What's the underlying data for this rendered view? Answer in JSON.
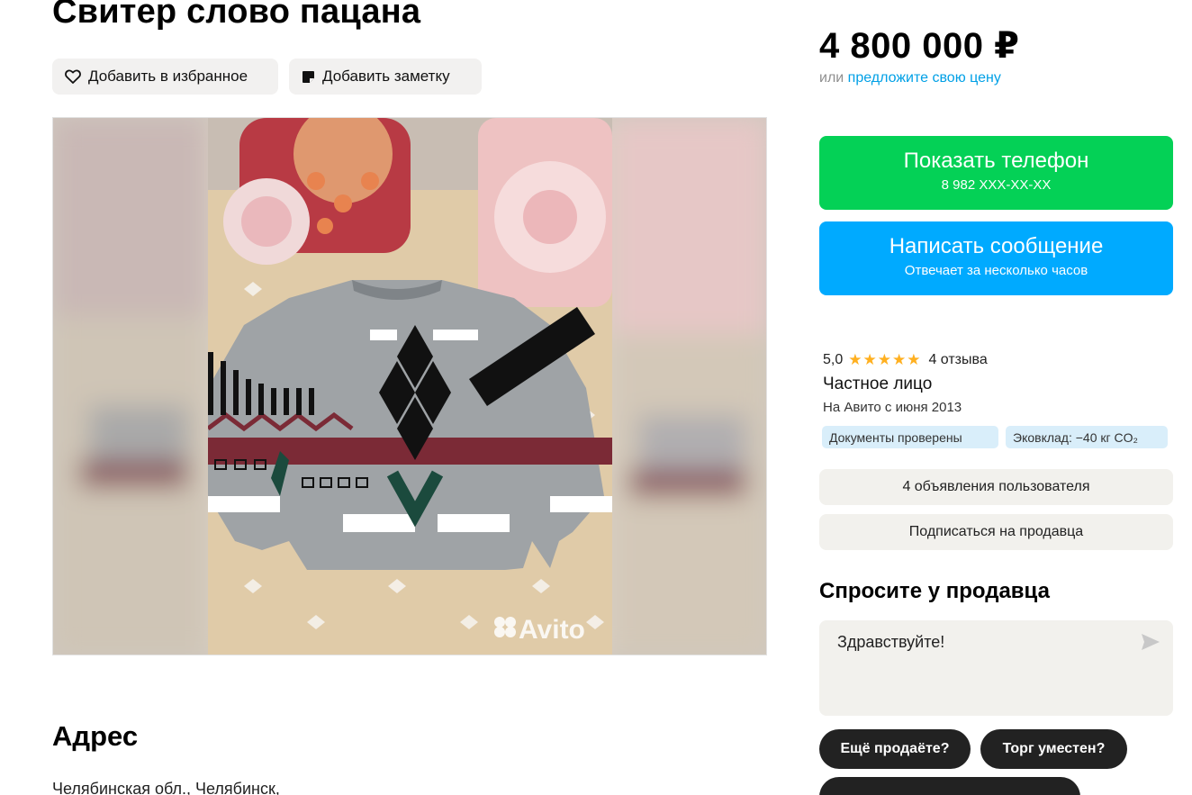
{
  "listing": {
    "title": "Свитер слово пацана",
    "favorite_label": "Добавить в избранное",
    "note_label": "Добавить заметку",
    "photo_watermark": "Avito"
  },
  "address": {
    "heading": "Адрес",
    "text": "Челябинская обл., Челябинск,"
  },
  "price": {
    "value": "4 800 000 ₽",
    "offer_prefix": "или",
    "offer_link": "предложите свою цену"
  },
  "actions": {
    "phone_label": "Показать телефон",
    "phone_number": "8 982 XXX-XX-XX",
    "message_label": "Написать сообщение",
    "message_sub": "Отвечает за несколько часов"
  },
  "seller": {
    "rating": "5,0",
    "rating_stars": 5,
    "reviews": "4 отзыва",
    "type": "Частное лицо",
    "since": "На Авито с июня 2013",
    "badge_docs": "Документы проверены",
    "badge_eco": "Эковклад: −40 кг CO₂",
    "ads_button": "4 объявления пользователя",
    "subscribe_button": "Подписаться на продавца"
  },
  "ask": {
    "heading": "Спросите у продавца",
    "message": "Здравствуйте!",
    "quick_questions": [
      "Ещё продаёте?",
      "Торг уместен?",
      ""
    ]
  },
  "colors": {
    "green": "#04d156",
    "blue": "#00aaff",
    "link": "#00a0e6",
    "star": "#ffb020"
  }
}
